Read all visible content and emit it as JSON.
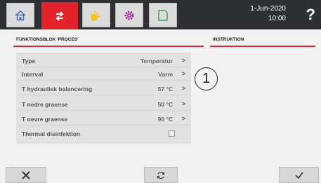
{
  "header": {
    "tabs": [
      {
        "icon": "home-icon"
      },
      {
        "icon": "process-icon",
        "active": true
      },
      {
        "icon": "sun-icon"
      },
      {
        "icon": "gear-icon"
      },
      {
        "icon": "document-icon"
      }
    ],
    "date": "1-Jun-2020",
    "time": "10:00",
    "help_label": "?"
  },
  "left_section": {
    "title": "FUNKTIONSBLOK 'PROCES'",
    "rows": [
      {
        "label": "Type",
        "value": "Temperatur",
        "chevron": ">"
      },
      {
        "label": "Interval",
        "value": "Varm",
        "chevron": ">"
      },
      {
        "label": "T hydraulisk balancering",
        "value": "57 °C",
        "chevron": ">"
      },
      {
        "label": "T nedre graense",
        "value": "50 °C",
        "chevron": ">"
      },
      {
        "label": "T oevre graense",
        "value": "90 °C",
        "chevron": ">"
      },
      {
        "label": "Thermal disinfektion",
        "checked": false
      }
    ]
  },
  "right_section": {
    "title": "INSTRUKTION"
  },
  "callout": "1",
  "footer": {
    "cancel_icon": "close-icon",
    "reset_icon": "refresh-icon",
    "confirm_icon": "check-icon"
  },
  "colors": {
    "accent": "#e32329",
    "topbar": "#2e3033",
    "panel": "#e2e2e2"
  }
}
